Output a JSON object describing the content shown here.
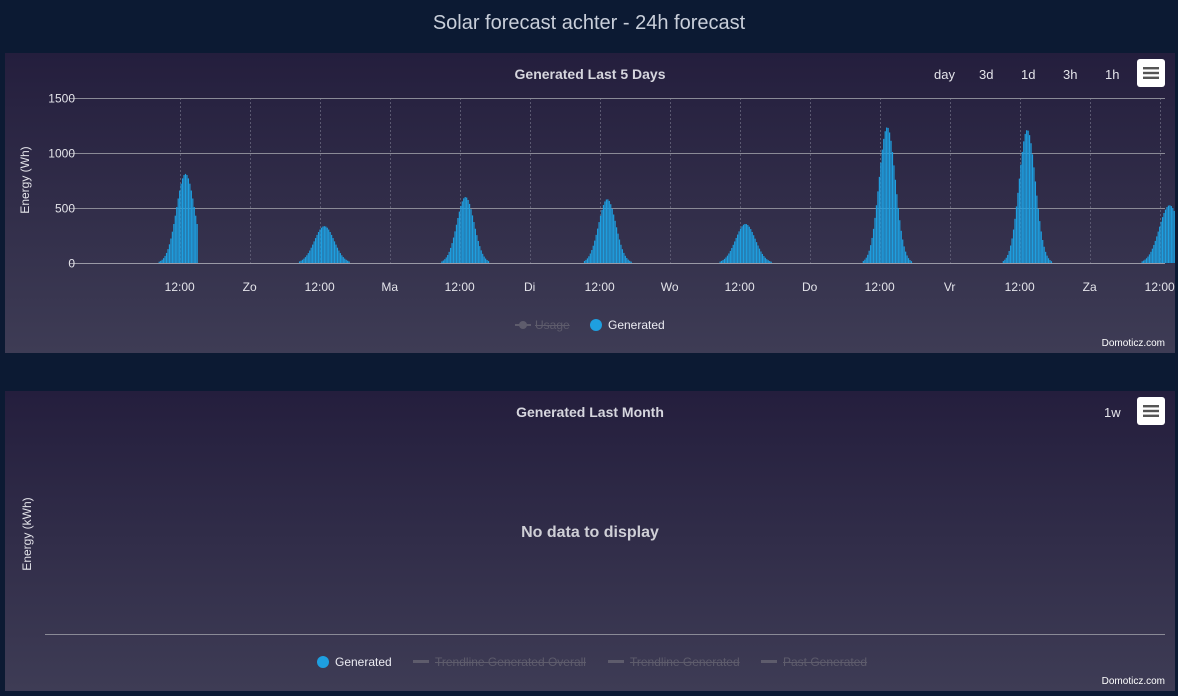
{
  "page": {
    "title": "Solar forecast achter - 24h forecast"
  },
  "chart1": {
    "title": "Generated Last 5 Days",
    "range_buttons": [
      "day",
      "3d",
      "1d",
      "3h",
      "1h"
    ],
    "menu_icon": "hamburger-icon",
    "ylabel": "Energy (Wh)",
    "credit": "Domoticz.com",
    "legend": [
      {
        "label": "Usage",
        "active": false
      },
      {
        "label": "Generated",
        "active": true
      }
    ]
  },
  "chart2": {
    "title": "Generated Last Month",
    "range_buttons": [
      "1w"
    ],
    "menu_icon": "hamburger-icon",
    "ylabel": "Energy (kWh)",
    "no_data": "No data to display",
    "credit": "Domoticz.com",
    "legend": [
      {
        "label": "Generated",
        "active": true
      },
      {
        "label": "Trendline Generated Overall",
        "active": false
      },
      {
        "label": "Trendline Generated",
        "active": false
      },
      {
        "label": "Past Generated",
        "active": false
      }
    ]
  },
  "colors": {
    "generated": "#1e9fe0",
    "inactive": "#5e5c6c",
    "background": "#0c1a33"
  },
  "chart_data": [
    {
      "type": "bar",
      "title": "Generated Last 5 Days",
      "xlabel": "",
      "ylabel": "Energy (Wh)",
      "ylim": [
        0,
        1500
      ],
      "yticks": [
        "0",
        "500",
        "1000",
        "1500"
      ],
      "xticks": [
        "12:00",
        "Zo",
        "12:00",
        "Ma",
        "12:00",
        "Di",
        "12:00",
        "Wo",
        "12:00",
        "Do",
        "12:00",
        "Vr",
        "12:00",
        "Za",
        "12:00"
      ],
      "grid": true,
      "legend": "bottom",
      "series": [
        {
          "name": "Generated",
          "days": [
            {
              "day_start": 0,
              "peak_hour": 13.0,
              "peak": 810,
              "width": 2.2,
              "start_hour": 7.0,
              "end_hour": 15.0
            },
            {
              "day_start": 1,
              "peak_hour": 12.8,
              "peak": 335,
              "width": 2.4,
              "start_hour": 7.3,
              "end_hour": 17.2
            },
            {
              "day_start": 2,
              "peak_hour": 13.0,
              "peak": 600,
              "width": 2.1,
              "start_hour": 7.2,
              "end_hour": 17.6
            },
            {
              "day_start": 3,
              "peak_hour": 13.3,
              "peak": 580,
              "width": 2.1,
              "start_hour": 7.4,
              "end_hour": 17.8
            },
            {
              "day_start": 4,
              "peak_hour": 13.0,
              "peak": 355,
              "width": 2.4,
              "start_hour": 7.4,
              "end_hour": 18.0
            },
            {
              "day_start": 5,
              "peak_hour": 13.3,
              "peak": 1235,
              "width": 2.0,
              "start_hour": 7.2,
              "end_hour": 18.0
            },
            {
              "day_start": 6,
              "peak_hour": 13.3,
              "peak": 1210,
              "width": 2.0,
              "start_hour": 7.2,
              "end_hour": 18.0
            },
            {
              "day_start": 7,
              "peak_hour": 13.7,
              "peak": 525,
              "width": 2.5,
              "start_hour": 7.0,
              "end_hour": 17.8
            }
          ]
        }
      ]
    },
    {
      "type": "bar",
      "title": "Generated Last Month",
      "ylabel": "Energy (kWh)",
      "series": [
        {
          "name": "Generated",
          "values": []
        }
      ]
    }
  ]
}
